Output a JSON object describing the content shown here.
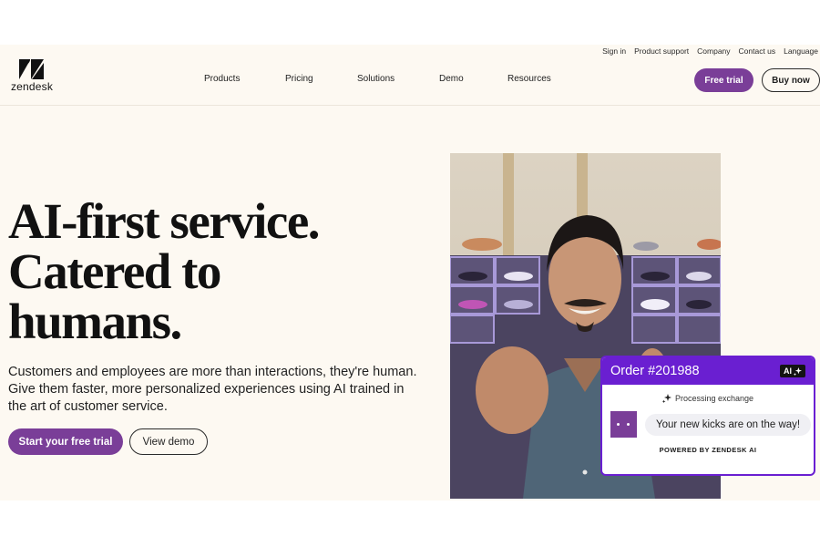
{
  "utility_nav": [
    "Sign in",
    "Product support",
    "Company",
    "Contact us",
    "Language"
  ],
  "logo": {
    "text": "zendesk",
    "icon": "zendesk-z-icon"
  },
  "main_nav": [
    "Products",
    "Pricing",
    "Solutions",
    "Demo",
    "Resources"
  ],
  "header_actions": {
    "free_trial": "Free trial",
    "buy_now": "Buy now"
  },
  "hero": {
    "headline": [
      "AI-first service.",
      "Catered to",
      "humans."
    ],
    "subheading": "Customers and employees are more than interactions, they're human. Give them faster, more personalized experiences using AI trained in the art of customer service.",
    "primary_cta": "Start your free trial",
    "secondary_cta": "View demo",
    "image_alt": "Smiling man in denim shirt making a finger-heart gesture in front of a sneaker shelf"
  },
  "ai_card": {
    "title": "Order #201988",
    "badge": "AI",
    "badge_icon": "sparkle-icon",
    "status": "Processing exchange",
    "status_icon": "sparkle-icon",
    "message": "Your new kicks are on the way!",
    "footer": "POWERED BY ZENDESK AI"
  },
  "colors": {
    "brand_purple": "#7a3e98",
    "card_purple": "#6a1fd1",
    "page_background": "#fdf9f2"
  }
}
